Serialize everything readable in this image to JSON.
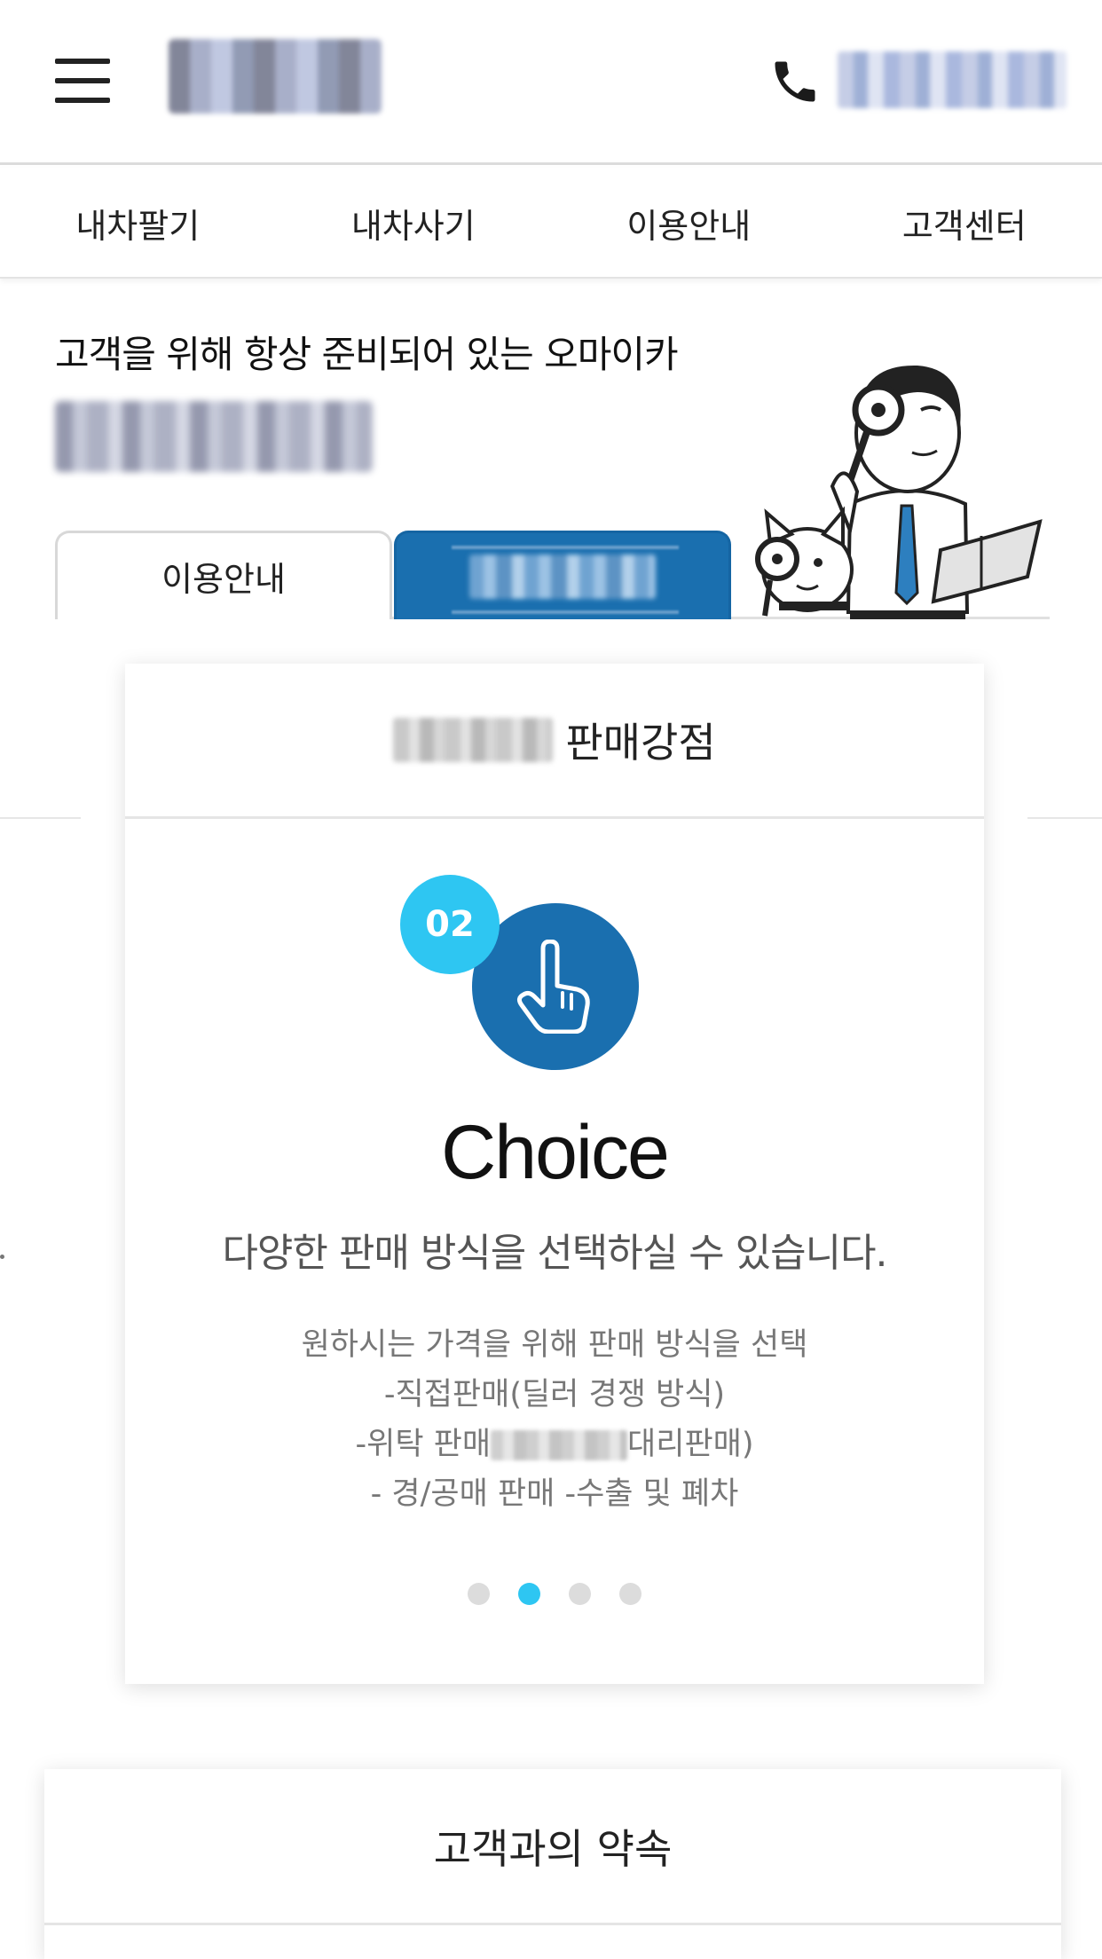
{
  "header": {
    "menu_icon": "hamburger-icon",
    "phone_icon": "phone-icon"
  },
  "nav": {
    "items": [
      {
        "label": "내차팔기"
      },
      {
        "label": "내차사기"
      },
      {
        "label": "이용안내"
      },
      {
        "label": "고객센터"
      }
    ]
  },
  "hero": {
    "title": "고객을 위해 항상 준비되어 있는 오마이카",
    "tabs": [
      {
        "label": "이용안내"
      },
      {
        "label": ""
      }
    ]
  },
  "strength_card": {
    "header_suffix": "판매강점",
    "number": "02",
    "icon": "hand-pointer-icon",
    "title": "Choice",
    "subtitle": "다양한 판매 방식을 선택하실 수 있습니다.",
    "desc_lines": [
      "원하시는 가격을 위해 판매 방식을 선택",
      "-직접판매(딜러 경쟁 방식)",
      "-위탁 판매",
      "대리판매)",
      "- 경/공매 판매 -수출 및 폐차"
    ],
    "pagination": {
      "total": 4,
      "active": 2
    }
  },
  "promise_card": {
    "title": "고객과의 약속"
  },
  "colors": {
    "accent_blue": "#1a6faf",
    "accent_cyan": "#2ec6f2",
    "text_gray": "#777777"
  }
}
